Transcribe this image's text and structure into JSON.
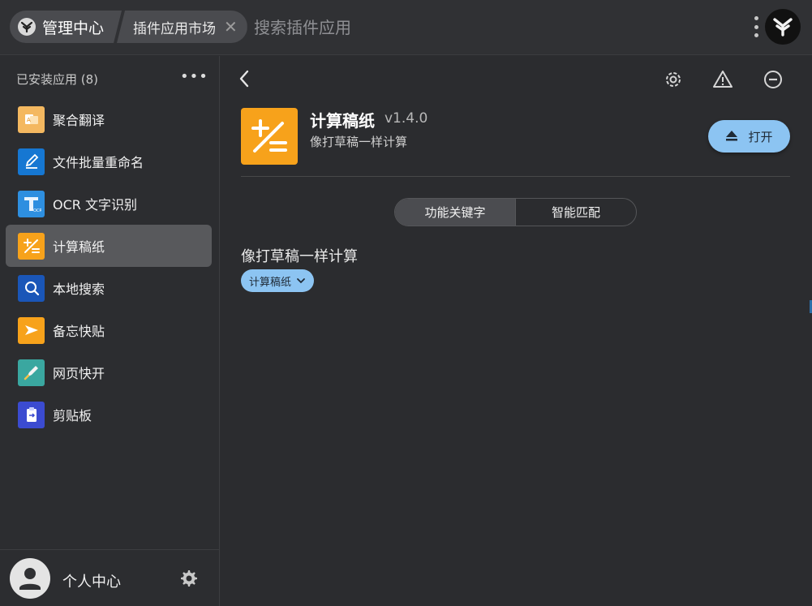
{
  "header": {
    "home_label": "管理中心",
    "current_tab": "插件应用市场",
    "search_placeholder": "搜索插件应用"
  },
  "sidebar": {
    "title": "已安装应用 (8)",
    "items": [
      {
        "label": "聚合翻译",
        "icon": "translate-icon",
        "color": "#f4b860"
      },
      {
        "label": "文件批量重命名",
        "icon": "rename-pen-icon",
        "color": "#1677d2"
      },
      {
        "label": "OCR 文字识别",
        "icon": "ocr-icon",
        "color": "#2e8fe0"
      },
      {
        "label": "计算稿纸",
        "icon": "calculator-icon",
        "color": "#f7a21b",
        "active": true
      },
      {
        "label": "本地搜索",
        "icon": "local-search-icon",
        "color": "#1a56b8"
      },
      {
        "label": "备忘快贴",
        "icon": "memo-icon",
        "color": "#f7a21b"
      },
      {
        "label": "网页快开",
        "icon": "rocket-icon",
        "color": "#3aa7a0"
      },
      {
        "label": "剪贴板",
        "icon": "clipboard-icon",
        "color": "#3b4bd0"
      }
    ],
    "footer": {
      "user_label": "个人中心"
    }
  },
  "plugin": {
    "name": "计算稿纸",
    "version": "v1.4.0",
    "description": "像打草稿一样计算",
    "open_label": "打开",
    "tabs": [
      "功能关键字",
      "智能匹配"
    ],
    "selected_tab": "功能关键字",
    "feature_title": "像打草稿一样计算",
    "keyword_chip": "计算稿纸"
  },
  "colors": {
    "accent": "#8cc4f2",
    "plugin_orange": "#f7a21b",
    "background": "#2b2c2f"
  }
}
